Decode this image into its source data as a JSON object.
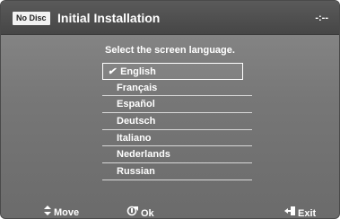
{
  "header": {
    "badge": "No Disc",
    "title": "Initial Installation",
    "clock": "-:--"
  },
  "prompt": "Select the screen language.",
  "languages": {
    "items": [
      {
        "label": "English",
        "selected": true,
        "mark": "✔"
      },
      {
        "label": "Français"
      },
      {
        "label": "Español"
      },
      {
        "label": "Deutsch"
      },
      {
        "label": "Italiano"
      },
      {
        "label": "Nederlands"
      },
      {
        "label": "Russian"
      }
    ]
  },
  "footer": {
    "move_label": "Move",
    "move_icon": "up-down-arrow-icon",
    "ok_label": "Ok",
    "ok_icon": "enter-icon",
    "exit_label": "Exit",
    "exit_icon": "exit-icon"
  }
}
